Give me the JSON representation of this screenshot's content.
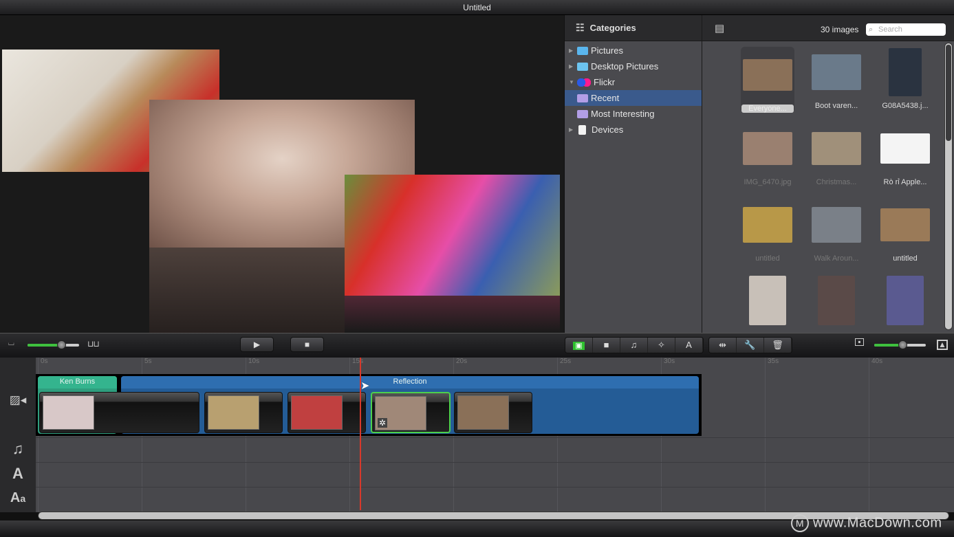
{
  "window": {
    "title": "Untitled"
  },
  "preview": {
    "photos": [
      {
        "name": "kids-with-apples",
        "colors": [
          "#e9e4dc",
          "#b88a5a",
          "#7ea3c8",
          "#5fa84a"
        ]
      },
      {
        "name": "newborn-baby",
        "colors": [
          "#b9988a",
          "#d9c3b6",
          "#8d7064",
          "#9aa0a8"
        ]
      },
      {
        "name": "girls-on-playground",
        "colors": [
          "#d8302a",
          "#e64ea8",
          "#3a5fb0",
          "#6a8e3c"
        ]
      }
    ]
  },
  "sidebar": {
    "header": "Categories",
    "items": [
      {
        "label": "Pictures",
        "icon": "pictures-folder-icon",
        "expand": "collapsed",
        "color": "#5ab6ee"
      },
      {
        "label": "Desktop Pictures",
        "icon": "folder-icon",
        "expand": "collapsed",
        "color": "#6cc4f0"
      },
      {
        "label": "Flickr",
        "icon": "flickr-icon",
        "expand": "expanded",
        "color": "#ff1a8c"
      },
      {
        "label": "Recent",
        "icon": "smart-folder-icon",
        "expand": "none",
        "color": "#b29ee6",
        "selected": true
      },
      {
        "label": "Most Interesting",
        "icon": "smart-folder-icon",
        "expand": "none",
        "color": "#b29ee6"
      },
      {
        "label": "Devices",
        "icon": "document-icon",
        "expand": "collapsed",
        "color": "#f2f2f2"
      }
    ]
  },
  "browser": {
    "count": "30 images",
    "search_placeholder": "Search",
    "images": [
      {
        "caption": "Everyone...",
        "state": "selected",
        "bg": "#8a7058"
      },
      {
        "caption": "Boot varen...",
        "state": "normal",
        "bg": "#6a7a8a"
      },
      {
        "caption": "G08A5438.j...",
        "state": "normal",
        "bg": "#2a3340"
      },
      {
        "caption": "IMG_6470.jpg",
        "state": "dim",
        "bg": "#9a8070"
      },
      {
        "caption": "Christmas...",
        "state": "dim",
        "bg": "#a0907a"
      },
      {
        "caption": "Rò rỉ Apple...",
        "state": "normal",
        "bg": "#f4f4f4"
      },
      {
        "caption": "untitled",
        "state": "dim",
        "bg": "#b89848"
      },
      {
        "caption": "Walk Aroun...",
        "state": "dim",
        "bg": "#7a8088"
      },
      {
        "caption": "untitled",
        "state": "normal",
        "bg": "#9a7a58"
      },
      {
        "caption": "",
        "state": "normal",
        "bg": "#c8c0b8"
      },
      {
        "caption": "",
        "state": "normal",
        "bg": "#5a4a48"
      },
      {
        "caption": "",
        "state": "normal",
        "bg": "#5a5a90"
      }
    ]
  },
  "toolbar": {
    "play_label": "▶",
    "stop_label": "■",
    "timeline_zoom": 0.65,
    "thumb_size": 0.55,
    "tools": [
      {
        "name": "photo-tool",
        "glyph": "▣",
        "active": true
      },
      {
        "name": "video-tool",
        "glyph": "■",
        "active": false
      },
      {
        "name": "music-tool",
        "glyph": "♫",
        "active": false
      },
      {
        "name": "effects-tool",
        "glyph": "✧",
        "active": false
      },
      {
        "name": "text-tool",
        "glyph": "A",
        "active": false
      }
    ],
    "edit_tools": [
      {
        "name": "split-tool",
        "glyph": "⇹"
      },
      {
        "name": "settings-tool",
        "glyph": "🔧"
      },
      {
        "name": "delete-tool",
        "glyph": "🗑"
      }
    ]
  },
  "timeline": {
    "ticks": [
      "0s",
      "5s",
      "10s",
      "15s",
      "20s",
      "25s",
      "30s",
      "35s",
      "40s"
    ],
    "playhead_seconds": 15.5,
    "transitions": [
      {
        "label": "Ken Burns",
        "color": "#34b48e"
      },
      {
        "label": "Reflection",
        "color": "#2e6eb0"
      }
    ],
    "clips": [
      {
        "name": "twin-babies",
        "bg": "#d8c8c8"
      },
      {
        "name": "kids-with-apples",
        "bg": "#b8a070"
      },
      {
        "name": "girls-on-playground",
        "bg": "#c04040"
      },
      {
        "name": "newborn-baby",
        "bg": "#a08878",
        "selected": true
      },
      {
        "name": "kitten",
        "bg": "#8a7058"
      }
    ],
    "track_icons": [
      "photo-video-track-icon",
      "music-track-icon",
      "title-track-icon",
      "caption-track-icon"
    ]
  },
  "watermark": "www.MacDown.com"
}
